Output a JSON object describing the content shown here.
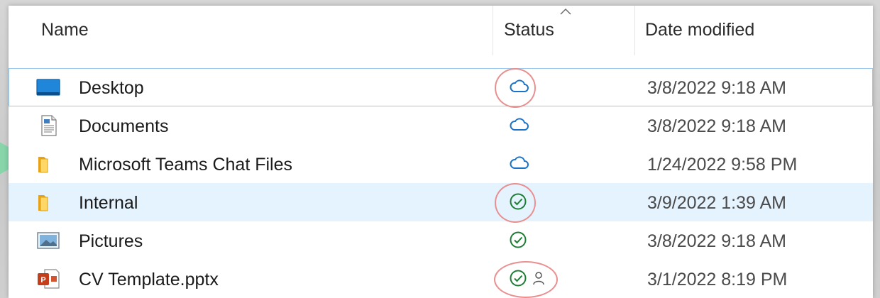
{
  "columns": {
    "name": "Name",
    "status": "Status",
    "date_modified": "Date modified",
    "sorted_by": "Status"
  },
  "files": [
    {
      "name": "Desktop",
      "icon": "desktop-icon",
      "status": "available-online-only",
      "status_icon": "cloud-icon",
      "date": "3/8/2022 9:18 AM",
      "focused": true,
      "selected": false,
      "highlighted": true
    },
    {
      "name": "Documents",
      "icon": "document-icon",
      "status": "available-online-only",
      "status_icon": "cloud-icon",
      "date": "3/8/2022 9:18 AM",
      "focused": false,
      "selected": false,
      "highlighted": false
    },
    {
      "name": "Microsoft Teams Chat Files",
      "icon": "folder-icon",
      "status": "available-online-only",
      "status_icon": "cloud-icon",
      "date": "1/24/2022 9:58 PM",
      "focused": false,
      "selected": false,
      "highlighted": false
    },
    {
      "name": "Internal",
      "icon": "folder-icon",
      "status": "available-on-device",
      "status_icon": "check-circle-icon",
      "date": "3/9/2022 1:39 AM",
      "focused": false,
      "selected": true,
      "highlighted": true
    },
    {
      "name": "Pictures",
      "icon": "pictures-icon",
      "status": "available-on-device",
      "status_icon": "check-circle-icon",
      "date": "3/8/2022 9:18 AM",
      "focused": false,
      "selected": false,
      "highlighted": false
    },
    {
      "name": "CV Template.pptx",
      "icon": "powerpoint-file-icon",
      "status": "available-on-device-shared",
      "status_icon": "check-circle-icon",
      "extra_status_icon": "person-icon",
      "date": "3/1/2022 8:19 PM",
      "focused": false,
      "selected": false,
      "highlighted": true
    }
  ],
  "colors": {
    "cloud": "#1a73c8",
    "check": "#1e7d34",
    "highlight_ring": "#e98f8f",
    "selected_row": "#e5f3ff",
    "focus_border": "#99c9ef"
  }
}
